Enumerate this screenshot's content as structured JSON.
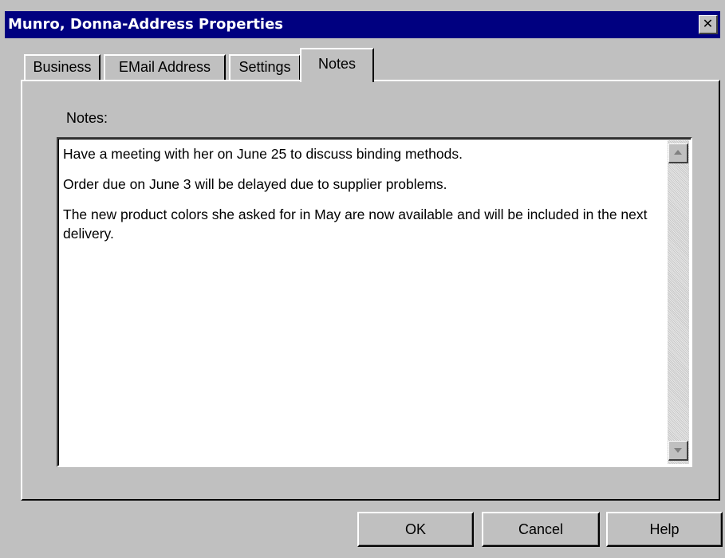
{
  "window": {
    "title": "Munro, Donna-Address Properties",
    "close_label": "✕"
  },
  "tabs": [
    {
      "label": "Business",
      "selected": false
    },
    {
      "label": "EMail Address",
      "selected": false
    },
    {
      "label": "Settings",
      "selected": false
    },
    {
      "label": "Notes",
      "selected": true
    }
  ],
  "notes": {
    "label": "Notes:",
    "paragraphs": [
      "Have a meeting with her on June 25 to discuss binding methods.",
      "Order due on June 3 will be delayed due to supplier problems.",
      "The new product colors she asked for in May are now available and will be included in the next delivery."
    ]
  },
  "buttons": {
    "ok": "OK",
    "cancel": "Cancel",
    "help": "Help"
  },
  "colors": {
    "titlebar": "#000080",
    "face": "#c0c0c0",
    "field": "#ffffff"
  },
  "icons": {
    "close": "close-icon",
    "scroll_up": "arrow-up-icon",
    "scroll_down": "arrow-down-icon"
  }
}
